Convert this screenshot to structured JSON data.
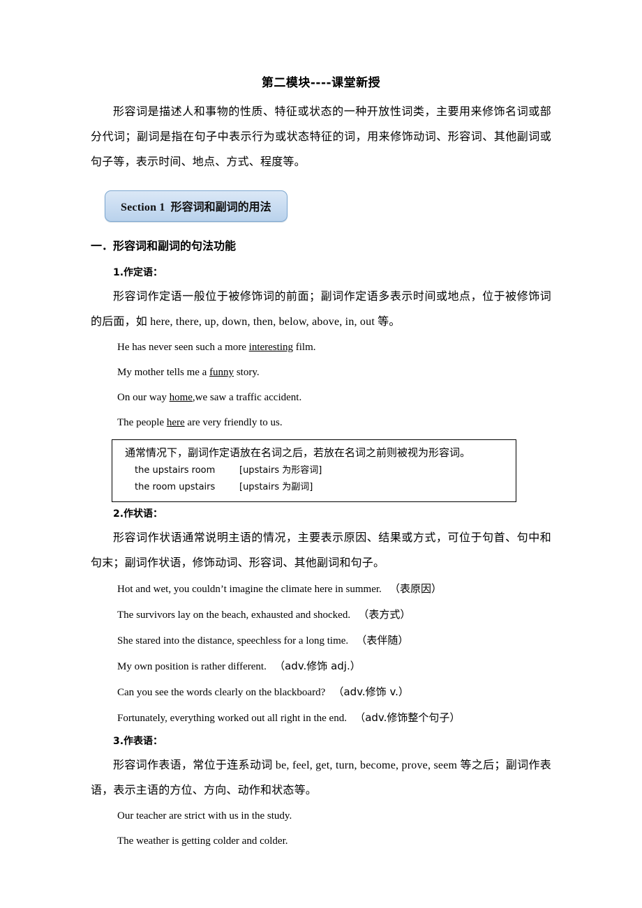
{
  "document": {
    "title": "第二模块----课堂新授",
    "intro": "形容词是描述人和事物的性质、特征或状态的一种开放性词类，主要用来修饰名词或部分代词；副词是指在句子中表示行为或状态特征的词，用来修饰动词、形容词、其他副词或句子等，表示时间、地点、方式、程度等。"
  },
  "section_banner": {
    "english": "Section 1",
    "chinese": "形容词和副词的用法",
    "border_color": "#7da7d0",
    "fill_top": "#dbe8f6",
    "fill_bottom": "#b9d2ec"
  },
  "heading_main": "一．形容词和副词的句法功能",
  "subsections": [
    {
      "heading": "1.作定语：",
      "body": "形容词作定语一般位于被修饰词的前面；副词作定语多表示时间或地点，位于被修饰词的后面，如 here, there, up, down, then, below, above, in, out 等。",
      "examples": [
        {
          "pre": "He has never seen such a more ",
          "underline": "interesting",
          "post": " film."
        },
        {
          "pre": "My mother tells me a ",
          "underline": "funny",
          "post": " story."
        },
        {
          "pre": "On our way ",
          "underline": "home",
          "post": ",we saw a traffic accident."
        },
        {
          "pre": "The people ",
          "underline": "here",
          "post": " are very friendly to us."
        }
      ]
    },
    {
      "heading": "2.作状语：",
      "body": "形容词作状语通常说明主语的情况，主要表示原因、结果或方式，可位于句首、句中和句末；副词作状语，修饰动词、形容词、其他副词和句子。",
      "examples": [
        {
          "pre": "Hot and wet, you couldn’t imagine the climate here in summer.",
          "note": "（表原因）"
        },
        {
          "pre": "The survivors lay on the beach, exhausted and shocked.",
          "note": "（表方式）"
        },
        {
          "pre": "She stared into the distance, speechless for a long time.",
          "note": "（表伴随）"
        },
        {
          "pre": "My own position is rather different.",
          "note": "（adv.修饰 adj.）"
        },
        {
          "pre": "Can you see the words clearly on the blackboard?",
          "note": "（adv.修饰 v.）"
        },
        {
          "pre": "Fortunately, everything worked out all right in the end.",
          "note": "（adv.修饰整个句子）"
        }
      ]
    },
    {
      "heading": "3.作表语：",
      "body": "形容词作表语，常位于连系动词 be, feel, get, turn, become, prove, seem 等之后；副词作表语，表示主语的方位、方向、动作和状态等。",
      "examples": [
        {
          "pre": "Our teacher are strict with us in the study."
        },
        {
          "pre": "The weather is getting colder and colder."
        }
      ]
    }
  ],
  "note_box": {
    "head": "通常情况下，副词作定语放在名词之后，若放在名词之前则被视为形容词。",
    "rows": [
      {
        "term": "the upstairs room",
        "gloss": "[upstairs 为形容词]"
      },
      {
        "term": "the room upstairs",
        "gloss": "[upstairs 为副词]"
      }
    ]
  }
}
